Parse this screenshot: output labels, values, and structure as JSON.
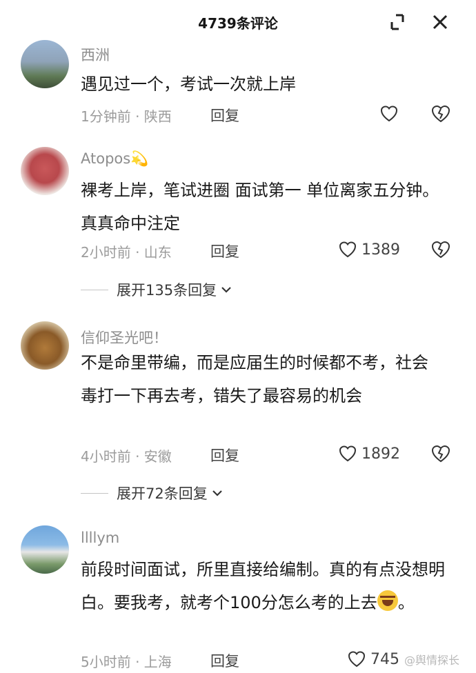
{
  "header": {
    "title": "4739条评论"
  },
  "comments": [
    {
      "user": "西洲",
      "text": "遇见过一个，考试一次就上岸",
      "meta": "1分钟前 · 陕西",
      "reply": "回复",
      "likes": ""
    },
    {
      "user": "Atopos💫",
      "text": "裸考上岸，笔试进圈 面试第一 单位离家五分钟。真真命中注定",
      "meta": "2小时前 · 山东",
      "reply": "回复",
      "likes": "1389",
      "expand": "展开135条回复"
    },
    {
      "user": "信仰圣光吧！",
      "text": "不是命里带编，而是应届生的时候都不考，社会毒打一下再去考，错失了最容易的机会",
      "meta": "4小时前 · 安徽",
      "reply": "回复",
      "likes": "1892",
      "expand": "展开72条回复"
    },
    {
      "user": "llllym",
      "text": "前段时间面试，所里直接给编制。真的有点没想明白。要我考，就考个100分怎么考的上去",
      "text_end": "。",
      "meta": "5小时前 · 上海",
      "reply": "回复",
      "likes": "745"
    }
  ],
  "watermark": "@舆情探长",
  "icons": {
    "collapse": "collapse-corner-icon",
    "close": "close-icon",
    "like": "heart-outline-icon",
    "dislike": "broken-heart-icon",
    "expand": "chevron-down-icon",
    "emoji": "laughing-tears-emoji"
  }
}
